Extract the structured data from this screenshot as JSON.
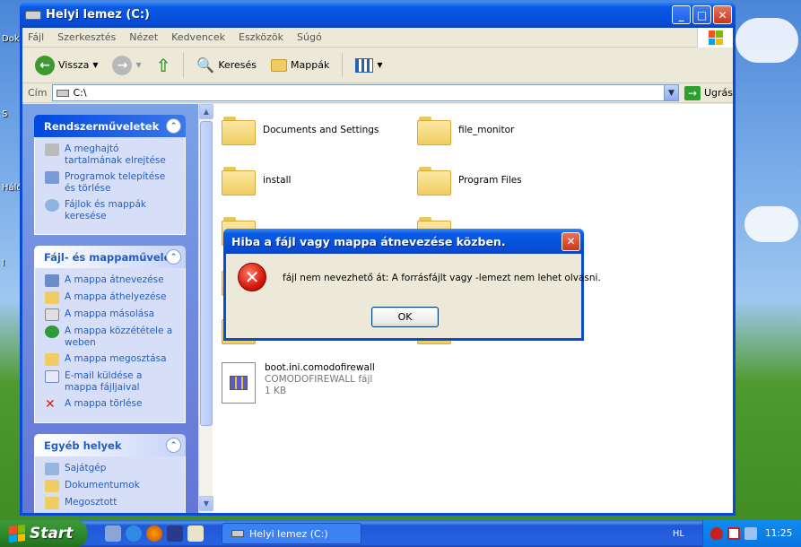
{
  "desktop": {
    "icons": [
      "Dok",
      "S",
      "Háló",
      "I"
    ]
  },
  "explorer": {
    "title": "Helyi lemez (C:)",
    "controls": {
      "minimize": "_",
      "maximize": "□",
      "close": "✕"
    },
    "menu": [
      "Fájl",
      "Szerkesztés",
      "Nézet",
      "Kedvencek",
      "Eszközök",
      "Súgó"
    ],
    "toolbar": {
      "back": "Vissza",
      "search": "Keresés",
      "folders": "Mappák"
    },
    "address": {
      "label": "Cím",
      "value": "C:\\",
      "go": "Ugrás"
    },
    "panels": {
      "system": {
        "title": "Rendszerműveletek",
        "tasks": [
          "A meghajtó tartalmának elrejtése",
          "Programok telepítése és törlése",
          "Fájlok és mappák keresése"
        ]
      },
      "file": {
        "title": "Fájl- és mappaművelet",
        "tasks": [
          "A mappa átnevezése",
          "A mappa áthelyezése",
          "A mappa másolása",
          "A mappa közzététele a weben",
          "A mappa megosztása",
          "E-mail küldése a mappa fájljaival",
          "A mappa törlése"
        ]
      },
      "other": {
        "title": "Egyéb helyek",
        "tasks": [
          "Sajátgép",
          "Dokumentumok",
          "Megosztott"
        ]
      }
    },
    "files": [
      {
        "name": "Documents and Settings"
      },
      {
        "name": "file_monitor"
      },
      {
        "name": "install"
      },
      {
        "name": "Program Files"
      },
      {
        "name": "boot.ini.comodofirewall",
        "type": "COMODOFIREWALL fájl",
        "size": "1 KB"
      }
    ]
  },
  "dialog": {
    "title": "Hiba a fájl vagy mappa átnevezése közben.",
    "icon": "error-icon",
    "message": "fájl nem nevezhető át: A forrásfájlt vagy -lemezt nem lehet olvasni.",
    "ok": "OK"
  },
  "taskbar": {
    "start": "Start",
    "task": "Helyi lemez (C:)",
    "lang": "HL",
    "clock": "11:25"
  },
  "colors": {
    "titlebar": "#0551dc",
    "panel_text": "#215dc6",
    "start_green": "#2e8b2e"
  }
}
